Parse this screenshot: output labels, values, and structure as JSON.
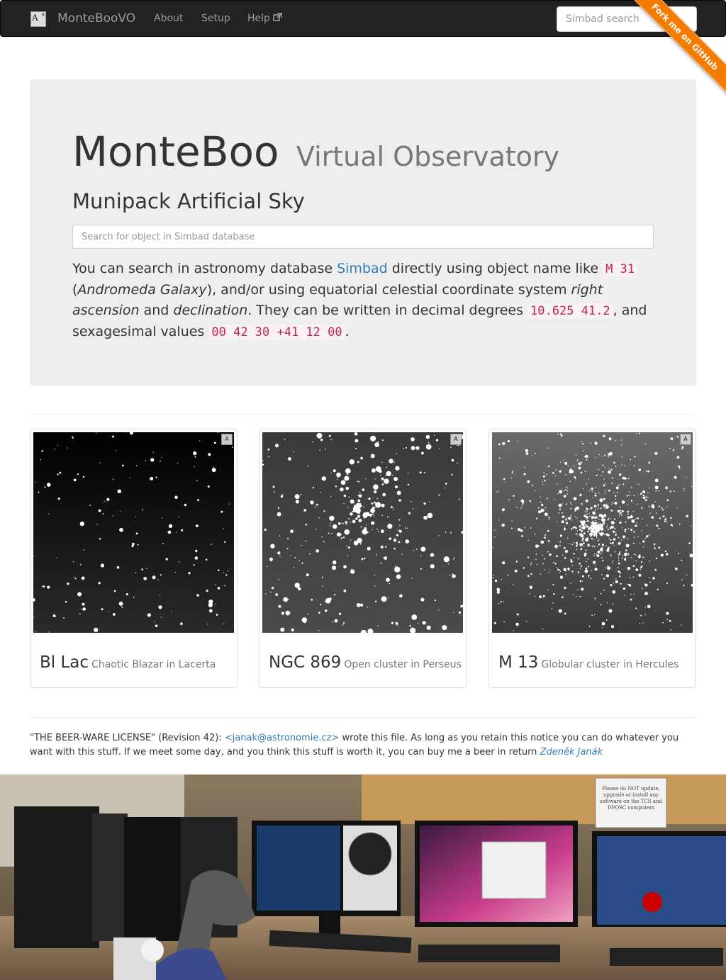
{
  "navbar": {
    "logo_text": "A",
    "logo_sup": "R",
    "brand": "MonteBooVO",
    "links": [
      "About",
      "Setup",
      "Help"
    ],
    "help_icon": "external-link-icon",
    "search_placeholder": "Simbad search",
    "ribbon": "Fork me on GitHub"
  },
  "jumbotron": {
    "title": "MonteBoo",
    "title_small": "Virtual Observatory",
    "subtitle": "Munipack Artificial Sky",
    "search_placeholder": "Search for object in Simbad database",
    "lead": {
      "t1": "You can search in astronomy database ",
      "link": "Simbad",
      "t2": " directly using object name like ",
      "code1": "M 31",
      "t3": " (",
      "em1": "Andromeda Galaxy",
      "t4": "), and/or using equatorial celestial coordinate system ",
      "em2": "right ascension",
      "t5": " and ",
      "em3": "declination",
      "t6": ". They can be written in decimal degrees ",
      "code2": "10.625 41.2",
      "t7": ", and sexagesimal values ",
      "code3": "00 42 30 +41 12 00",
      "t8": "."
    }
  },
  "thumbnails": [
    {
      "object": "Bl Lac",
      "description": "Chaotic Blazar in Lacerta",
      "badge": "A"
    },
    {
      "object": "NGC 869",
      "description": "Open cluster in Perseus",
      "badge": "A"
    },
    {
      "object": "M 13",
      "description": "Globular cluster in Hercules",
      "badge": "A"
    }
  ],
  "license": {
    "t1": "\"THE BEER-WARE LICENSE\" (Revision 42): ",
    "email": "<janak@astronomie.cz>",
    "t2": " wrote this file. As long as you retain this notice you can do whatever you want with this stuff. If we meet some day, and you think this stuff is worth it, you can buy me a beer in return ",
    "author": "Zdeněk Janák"
  },
  "photo": {
    "note": "Please do NOT update, upgrade or install any software on the TCS and DFOSC computers"
  }
}
